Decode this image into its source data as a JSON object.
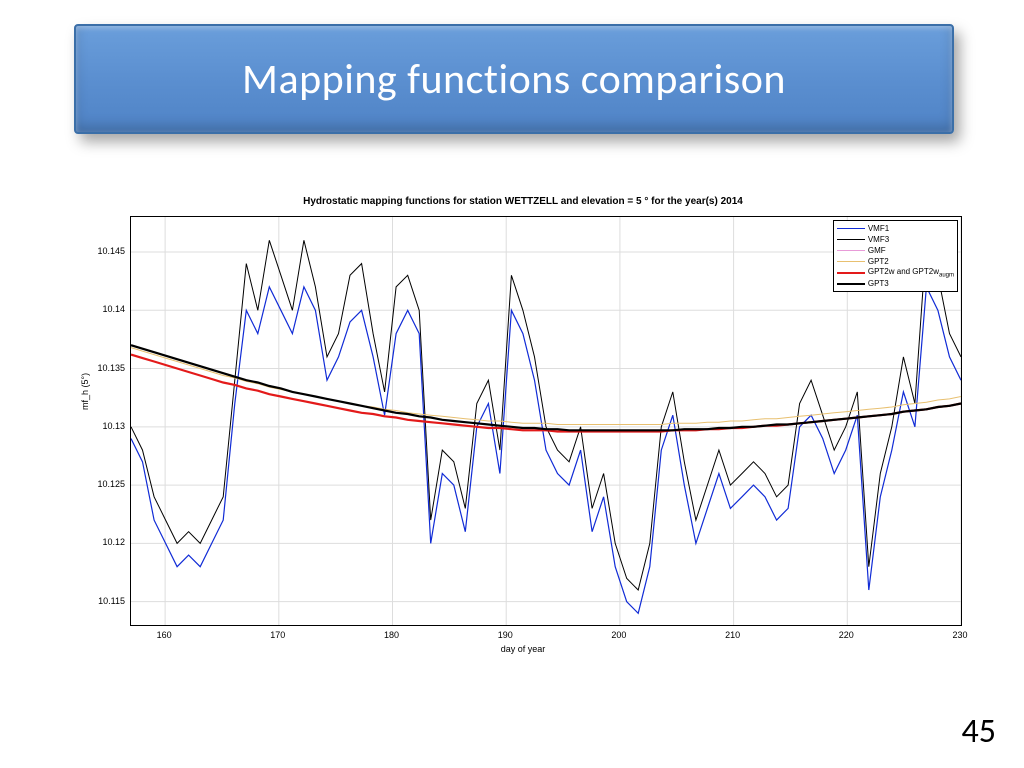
{
  "slide": {
    "title": "Mapping functions comparison",
    "page_number": "45"
  },
  "chart_data": {
    "type": "line",
    "title": "Hydrostatic mapping functions for station WETTZELL and elevation = 5 ° for the year(s) 2014",
    "xlabel": "day of year",
    "ylabel": "mf_h (5°)",
    "xlim": [
      157,
      230
    ],
    "ylim": [
      10.113,
      10.148
    ],
    "x_ticks": [
      160,
      170,
      180,
      190,
      200,
      210,
      220,
      230
    ],
    "y_ticks": [
      10.115,
      10.12,
      10.125,
      10.13,
      10.135,
      10.14,
      10.145
    ],
    "legend": [
      "VMF1",
      "VMF3",
      "GMF",
      "GPT2",
      "GPT2w and GPT2w_augm",
      "GPT3"
    ],
    "series": [
      {
        "name": "VMF1",
        "color": "#102bd6",
        "width": 1.2,
        "y": [
          10.129,
          10.127,
          10.122,
          10.12,
          10.118,
          10.119,
          10.118,
          10.12,
          10.122,
          10.132,
          10.14,
          10.138,
          10.142,
          10.14,
          10.138,
          10.142,
          10.14,
          10.134,
          10.136,
          10.139,
          10.14,
          10.136,
          10.131,
          10.138,
          10.14,
          10.138,
          10.12,
          10.126,
          10.125,
          10.121,
          10.13,
          10.132,
          10.126,
          10.14,
          10.138,
          10.134,
          10.128,
          10.126,
          10.125,
          10.128,
          10.121,
          10.124,
          10.118,
          10.115,
          10.114,
          10.118,
          10.128,
          10.131,
          10.125,
          10.12,
          10.123,
          10.126,
          10.123,
          10.124,
          10.125,
          10.124,
          10.122,
          10.123,
          10.13,
          10.131,
          10.129,
          10.126,
          10.128,
          10.131,
          10.116,
          10.124,
          10.128,
          10.133,
          10.13,
          10.142,
          10.14,
          10.136,
          10.134
        ]
      },
      {
        "name": "VMF3",
        "color": "#000000",
        "width": 1.0,
        "y": [
          10.13,
          10.128,
          10.124,
          10.122,
          10.12,
          10.121,
          10.12,
          10.122,
          10.124,
          10.134,
          10.144,
          10.14,
          10.146,
          10.143,
          10.14,
          10.146,
          10.142,
          10.136,
          10.138,
          10.143,
          10.144,
          10.138,
          10.133,
          10.142,
          10.143,
          10.14,
          10.122,
          10.128,
          10.127,
          10.123,
          10.132,
          10.134,
          10.128,
          10.143,
          10.14,
          10.136,
          10.13,
          10.128,
          10.127,
          10.13,
          10.123,
          10.126,
          10.12,
          10.117,
          10.116,
          10.12,
          10.13,
          10.133,
          10.127,
          10.122,
          10.125,
          10.128,
          10.125,
          10.126,
          10.127,
          10.126,
          10.124,
          10.125,
          10.132,
          10.134,
          10.131,
          10.128,
          10.13,
          10.133,
          10.118,
          10.126,
          10.13,
          10.136,
          10.132,
          10.146,
          10.143,
          10.138,
          10.136
        ]
      },
      {
        "name": "GMF",
        "color": "#e89bd8",
        "width": 1.0,
        "y": [
          10.137,
          10.1367,
          10.1364,
          10.1361,
          10.1358,
          10.1355,
          10.1352,
          10.1349,
          10.1346,
          10.1343,
          10.134,
          10.1338,
          10.1335,
          10.1333,
          10.133,
          10.1328,
          10.1326,
          10.1324,
          10.1322,
          10.132,
          10.1318,
          10.1316,
          10.1314,
          10.1312,
          10.1311,
          10.1309,
          10.1308,
          10.1306,
          10.1305,
          10.1304,
          10.1303,
          10.1302,
          10.1301,
          10.13,
          10.1299,
          10.1299,
          10.1298,
          10.1298,
          10.1297,
          10.1297,
          10.1297,
          10.1297,
          10.1297,
          10.1297,
          10.1297,
          10.1297,
          10.1297,
          10.1297,
          10.1298,
          10.1298,
          10.1298,
          10.1299,
          10.1299,
          10.13,
          10.13,
          10.1301,
          10.1302,
          10.1302,
          10.1303,
          10.1304,
          10.1305,
          10.1306,
          10.1307,
          10.1308,
          10.1309,
          10.131,
          10.1311,
          10.1313,
          10.1314,
          10.1315,
          10.1317,
          10.1318,
          10.132
        ]
      },
      {
        "name": "GPT2",
        "color": "#e8c070",
        "width": 1.0,
        "y": [
          10.1368,
          10.1365,
          10.1362,
          10.1359,
          10.1356,
          10.1353,
          10.135,
          10.1347,
          10.1344,
          10.1342,
          10.1339,
          10.1337,
          10.1334,
          10.1332,
          10.133,
          10.1328,
          10.1326,
          10.1324,
          10.1322,
          10.132,
          10.1318,
          10.1317,
          10.1315,
          10.1314,
          10.1312,
          10.1311,
          10.131,
          10.1309,
          10.1308,
          10.1307,
          10.1306,
          10.1305,
          10.1305,
          10.1304,
          10.1303,
          10.1303,
          10.1303,
          10.1302,
          10.1302,
          10.1302,
          10.1302,
          10.1302,
          10.1302,
          10.1302,
          10.1302,
          10.1302,
          10.1302,
          10.1303,
          10.1303,
          10.1303,
          10.1304,
          10.1304,
          10.1305,
          10.1305,
          10.1306,
          10.1307,
          10.1307,
          10.1308,
          10.1309,
          10.131,
          10.1311,
          10.1312,
          10.1313,
          10.1314,
          10.1315,
          10.1316,
          10.1317,
          10.1319,
          10.132,
          10.1321,
          10.1323,
          10.1324,
          10.1326
        ]
      },
      {
        "name": "GPT2w and GPT2w_augm",
        "color": "#e31a1a",
        "width": 2.2,
        "y": [
          10.1362,
          10.1359,
          10.1356,
          10.1353,
          10.135,
          10.1347,
          10.1344,
          10.1341,
          10.1338,
          10.1336,
          10.1333,
          10.1331,
          10.1328,
          10.1326,
          10.1324,
          10.1322,
          10.132,
          10.1318,
          10.1316,
          10.1314,
          10.1312,
          10.1311,
          10.1309,
          10.1308,
          10.1306,
          10.1305,
          10.1304,
          10.1303,
          10.1302,
          10.1301,
          10.13,
          10.1299,
          10.1299,
          10.1298,
          10.1297,
          10.1297,
          10.1297,
          10.1296,
          10.1296,
          10.1296,
          10.1296,
          10.1296,
          10.1296,
          10.1296,
          10.1296,
          10.1296,
          10.1296,
          10.1297,
          10.1297,
          10.1297,
          10.1298,
          10.1298,
          10.1299,
          10.1299,
          10.13,
          10.1301,
          10.1301,
          10.1302,
          10.1303,
          10.1304,
          10.1305,
          10.1306,
          10.1307,
          10.1308,
          10.1309,
          10.131,
          10.1311,
          10.1313,
          10.1314,
          10.1315,
          10.1317,
          10.1318,
          10.132
        ]
      },
      {
        "name": "GPT3",
        "color": "#000000",
        "width": 2.2,
        "y": [
          10.137,
          10.1367,
          10.1364,
          10.1361,
          10.1358,
          10.1355,
          10.1352,
          10.1349,
          10.1346,
          10.1343,
          10.134,
          10.1338,
          10.1335,
          10.1333,
          10.133,
          10.1328,
          10.1326,
          10.1324,
          10.1322,
          10.132,
          10.1318,
          10.1316,
          10.1314,
          10.1312,
          10.1311,
          10.1309,
          10.1308,
          10.1306,
          10.1305,
          10.1304,
          10.1303,
          10.1302,
          10.1301,
          10.13,
          10.1299,
          10.1299,
          10.1298,
          10.1298,
          10.1297,
          10.1297,
          10.1297,
          10.1297,
          10.1297,
          10.1297,
          10.1297,
          10.1297,
          10.1297,
          10.1297,
          10.1298,
          10.1298,
          10.1298,
          10.1299,
          10.1299,
          10.13,
          10.13,
          10.1301,
          10.1302,
          10.1302,
          10.1303,
          10.1304,
          10.1305,
          10.1306,
          10.1307,
          10.1308,
          10.1309,
          10.131,
          10.1311,
          10.1313,
          10.1314,
          10.1315,
          10.1317,
          10.1318,
          10.132
        ]
      }
    ]
  }
}
